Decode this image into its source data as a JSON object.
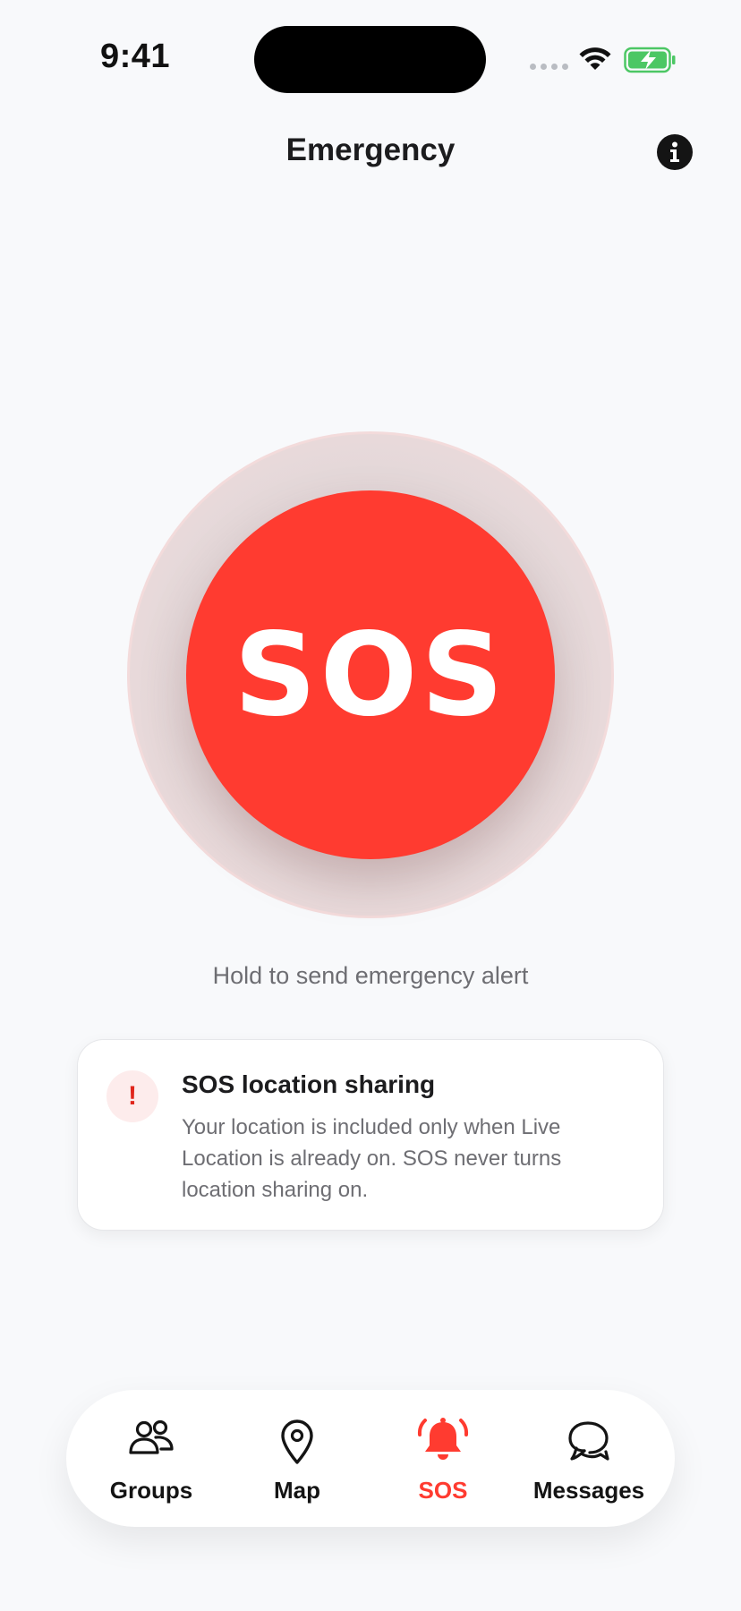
{
  "status_bar": {
    "time": "9:41"
  },
  "header": {
    "title": "Emergency",
    "info_icon": "info-icon"
  },
  "sos": {
    "button_label": "SOS",
    "hint": "Hold to send emergency alert",
    "accent_color": "#ff3b30"
  },
  "info_card": {
    "icon": "exclamation-icon",
    "icon_glyph": "!",
    "title": "SOS location sharing",
    "body": "Your location is included only when Live Location is already on. SOS never turns location sharing on."
  },
  "tab_bar": {
    "active_color": "#ff3b30",
    "items": [
      {
        "label": "Groups",
        "icon": "people-icon",
        "active": false
      },
      {
        "label": "Map",
        "icon": "map-pin-icon",
        "active": false
      },
      {
        "label": "SOS",
        "icon": "bell-icon",
        "active": true
      },
      {
        "label": "Messages",
        "icon": "chat-bubbles-icon",
        "active": false
      }
    ]
  }
}
